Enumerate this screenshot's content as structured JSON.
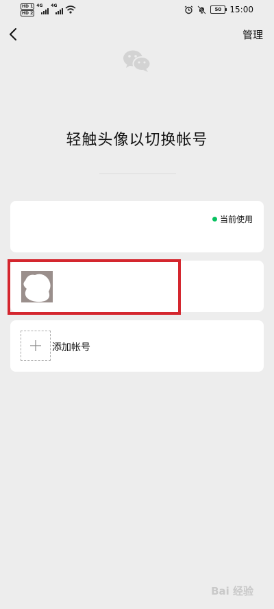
{
  "status_bar": {
    "hd1": "HD 1",
    "hd2": "HD 2",
    "net1": "4G",
    "net2": "4G",
    "battery": "50",
    "time": "15:00"
  },
  "header": {
    "manage_label": "管理"
  },
  "title": "轻触头像以切换帐号",
  "accounts": [
    {
      "status_label": "当前使用",
      "status_color": "#07c160"
    },
    {}
  ],
  "add_account": {
    "label": "添加帐号"
  },
  "watermark": "Bai 经验",
  "highlight_color": "#d4262e"
}
